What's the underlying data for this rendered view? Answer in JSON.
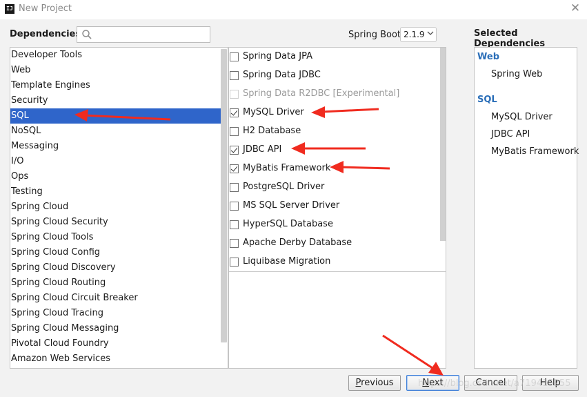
{
  "window": {
    "title": "New Project",
    "app_icon_text": "IJ"
  },
  "header": {
    "dependencies_label": "Dependencies",
    "search_placeholder": "",
    "spring_boot_label": "Spring Boot",
    "spring_boot_version": "2.1.9",
    "selected_title": "Selected Dependencies"
  },
  "categories": [
    {
      "label": "Developer Tools"
    },
    {
      "label": "Web"
    },
    {
      "label": "Template Engines"
    },
    {
      "label": "Security"
    },
    {
      "label": "SQL",
      "selected": true
    },
    {
      "label": "NoSQL"
    },
    {
      "label": "Messaging"
    },
    {
      "label": "I/O"
    },
    {
      "label": "Ops"
    },
    {
      "label": "Testing"
    },
    {
      "label": "Spring Cloud"
    },
    {
      "label": "Spring Cloud Security"
    },
    {
      "label": "Spring Cloud Tools"
    },
    {
      "label": "Spring Cloud Config"
    },
    {
      "label": "Spring Cloud Discovery"
    },
    {
      "label": "Spring Cloud Routing"
    },
    {
      "label": "Spring Cloud Circuit Breaker"
    },
    {
      "label": "Spring Cloud Tracing"
    },
    {
      "label": "Spring Cloud Messaging"
    },
    {
      "label": "Pivotal Cloud Foundry"
    },
    {
      "label": "Amazon Web Services"
    }
  ],
  "dependencies": [
    {
      "label": "Spring Data JPA",
      "checked": false,
      "disabled": false
    },
    {
      "label": "Spring Data JDBC",
      "checked": false,
      "disabled": false
    },
    {
      "label": "Spring Data R2DBC [Experimental]",
      "checked": false,
      "disabled": true
    },
    {
      "label": "MySQL Driver",
      "checked": true,
      "disabled": false
    },
    {
      "label": "H2 Database",
      "checked": false,
      "disabled": false
    },
    {
      "label": "JDBC API",
      "checked": true,
      "disabled": false
    },
    {
      "label": "MyBatis Framework",
      "checked": true,
      "disabled": false
    },
    {
      "label": "PostgreSQL Driver",
      "checked": false,
      "disabled": false
    },
    {
      "label": "MS SQL Server Driver",
      "checked": false,
      "disabled": false
    },
    {
      "label": "HyperSQL Database",
      "checked": false,
      "disabled": false
    },
    {
      "label": "Apache Derby Database",
      "checked": false,
      "disabled": false
    },
    {
      "label": "Liquibase Migration",
      "checked": false,
      "disabled": false
    }
  ],
  "selected": {
    "web_group": "Web",
    "web_items": [
      "Spring Web"
    ],
    "sql_group": "SQL",
    "sql_items": [
      "MySQL Driver",
      "JDBC API",
      "MyBatis Framework"
    ]
  },
  "buttons": {
    "previous": {
      "mnemonic": "P",
      "rest": "revious"
    },
    "next": {
      "mnemonic": "N",
      "rest": "ext"
    },
    "cancel": {
      "label": "Cancel"
    },
    "help": {
      "label": "Help"
    }
  },
  "watermark": "https://blog.csdn.net/a719415255",
  "colors": {
    "selection": "#2f65ca",
    "group_heading": "#2a6eb8",
    "annotation_arrow": "#f02b1f"
  }
}
